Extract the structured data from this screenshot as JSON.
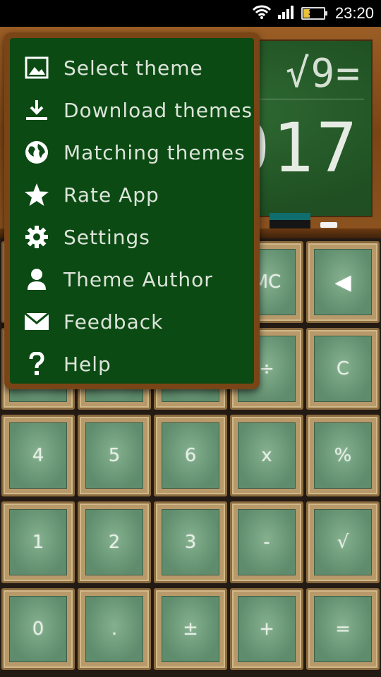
{
  "status_bar": {
    "time": "23:20",
    "battery_label": "30",
    "battery_level": 0.3,
    "icons": [
      "wifi-icon",
      "signal-icon",
      "battery-icon"
    ]
  },
  "display": {
    "expression": "√9=",
    "result": "017"
  },
  "menu": {
    "items": [
      {
        "label": "Select theme",
        "icon": "image-icon"
      },
      {
        "label": "Download themes",
        "icon": "download-icon"
      },
      {
        "label": "Matching themes",
        "icon": "globe-icon"
      },
      {
        "label": "Rate App",
        "icon": "star-icon"
      },
      {
        "label": "Settings",
        "icon": "gear-icon"
      },
      {
        "label": "Theme Author",
        "icon": "person-icon"
      },
      {
        "label": "Feedback",
        "icon": "envelope-icon"
      },
      {
        "label": "Help",
        "icon": "help-icon"
      }
    ]
  },
  "keypad": {
    "row1": [
      "MC",
      "◀"
    ],
    "row2": [
      "÷",
      "C"
    ],
    "row3": [
      "4",
      "5",
      "6",
      "x",
      "%"
    ],
    "row4": [
      "1",
      "2",
      "3",
      "-",
      "√"
    ],
    "row5": [
      "0",
      ".",
      "±",
      "+",
      "="
    ]
  },
  "colors": {
    "chalkboard": "#1f4f22",
    "frame": "#7a4516",
    "menu_bg": "#0c4a14",
    "key_face": "#6f9d7b"
  }
}
